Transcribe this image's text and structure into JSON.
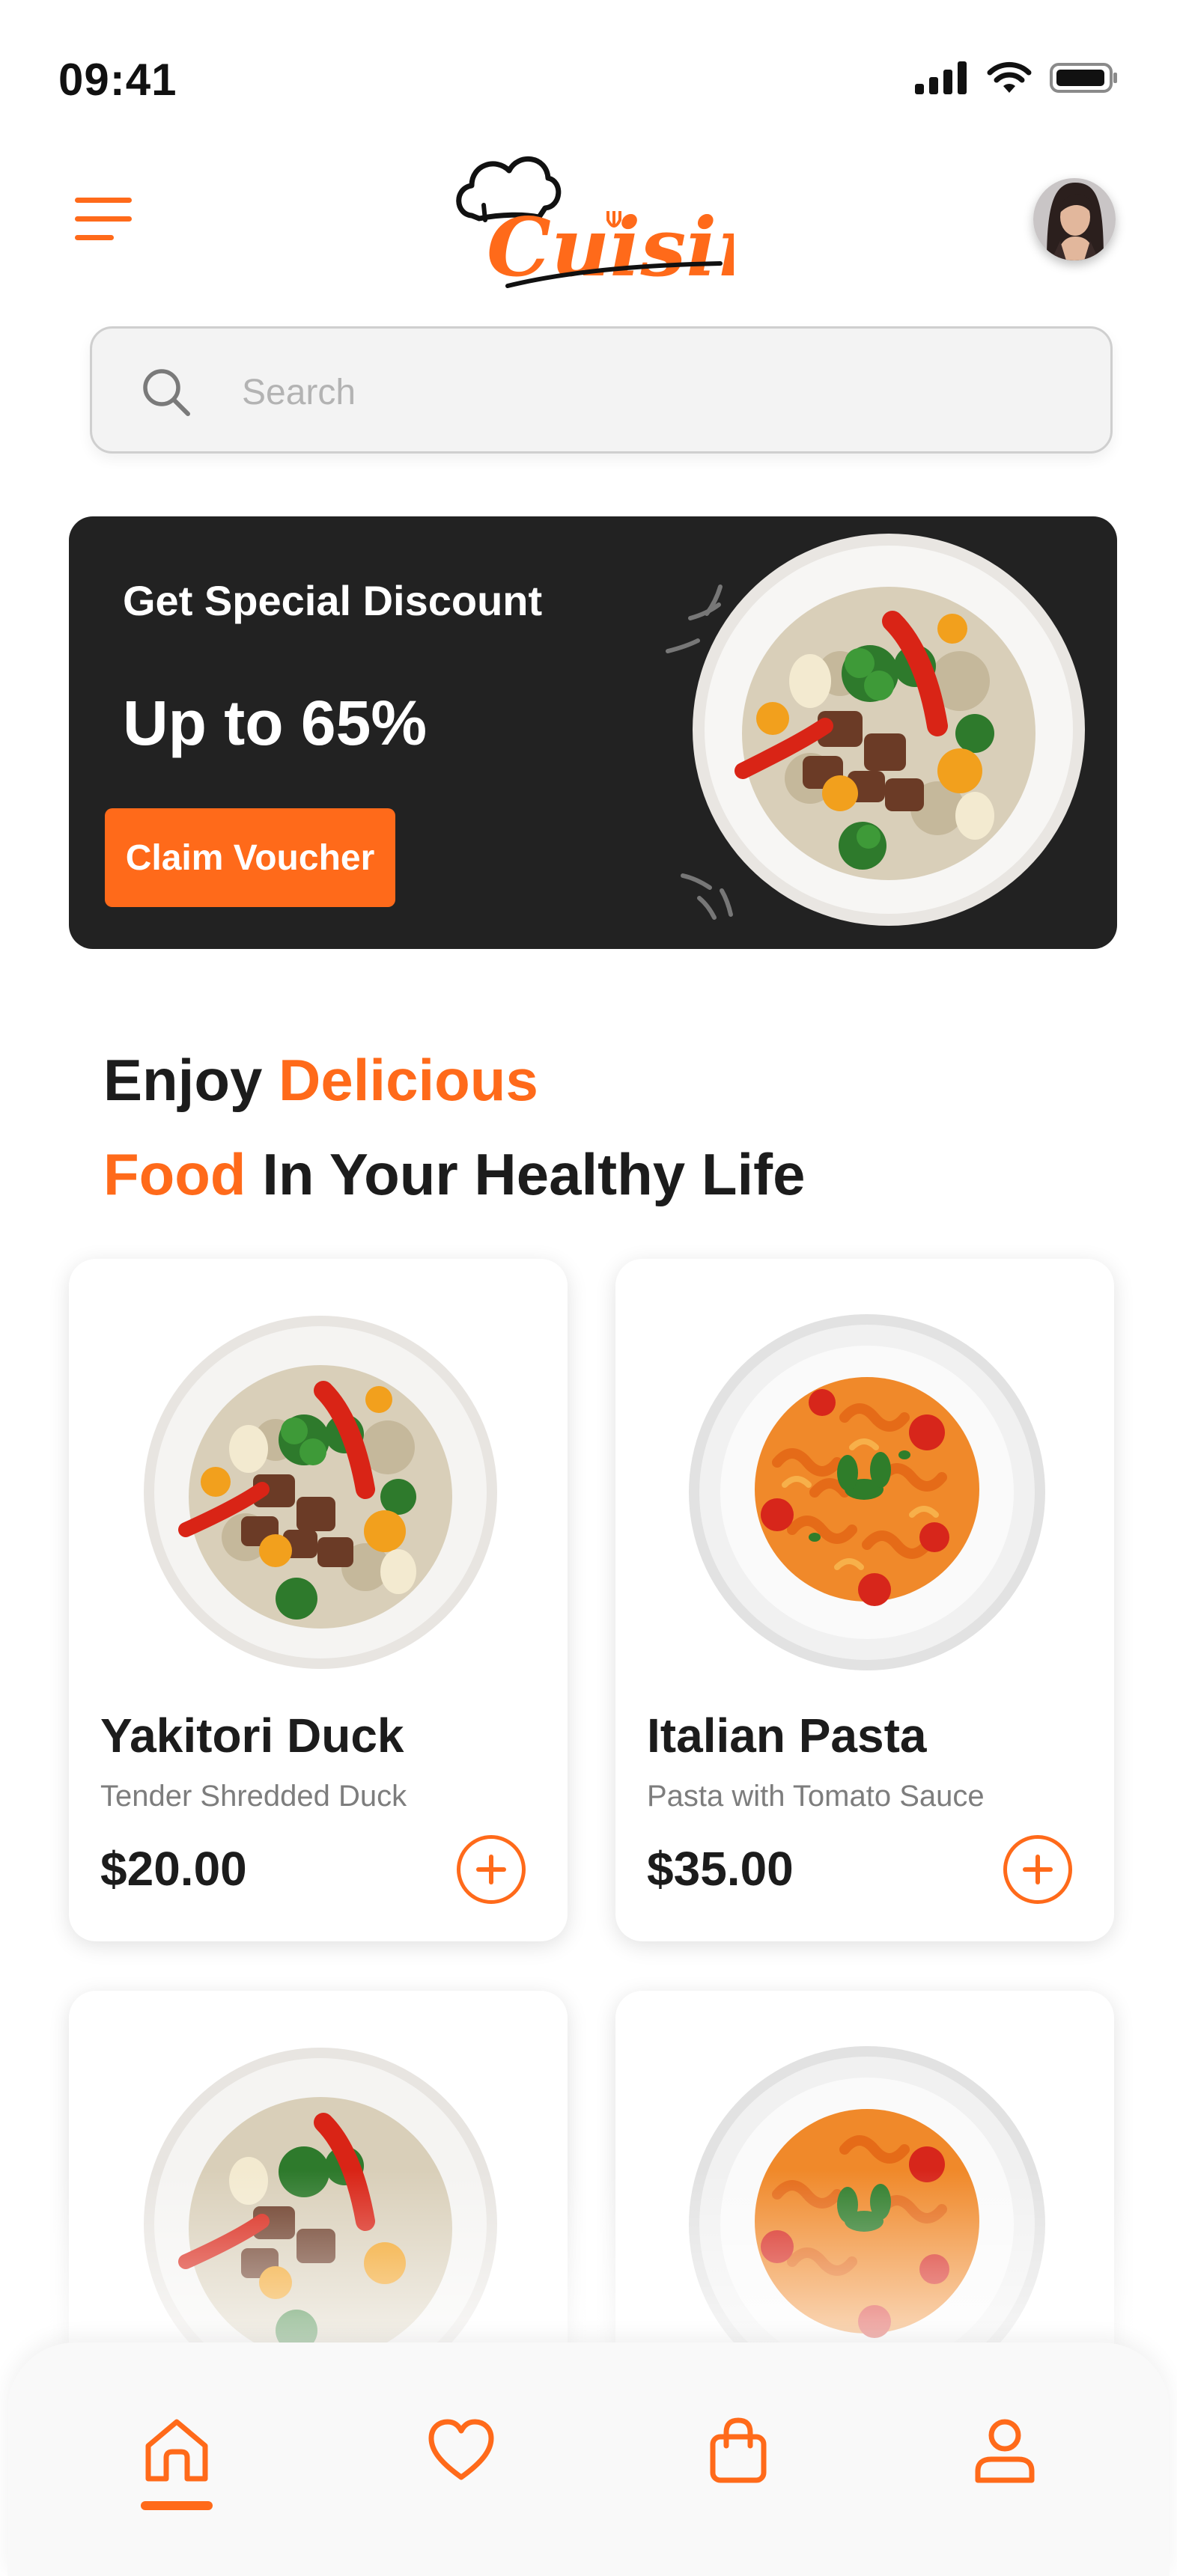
{
  "status_bar": {
    "time": "09:41"
  },
  "header": {
    "logo_text": "Cuisine"
  },
  "search": {
    "placeholder": "Search"
  },
  "promo": {
    "subtitle": "Get Special Discount",
    "title": "Up to 65%",
    "button_label": "Claim Voucher"
  },
  "headline": {
    "part1": "Enjoy ",
    "part2": "Delicious",
    "part3": "Food",
    "part4": " In Your Healthy Life"
  },
  "products": [
    {
      "name": "Yakitori Duck",
      "description": "Tender Shredded Duck",
      "price": "$20.00",
      "image": "duck-plate"
    },
    {
      "name": "Italian Pasta",
      "description": "Pasta with Tomato Sauce",
      "price": "$35.00",
      "image": "pasta-plate"
    },
    {
      "name": "",
      "description": "",
      "price": "",
      "image": "duck-plate"
    },
    {
      "name": "",
      "description": "",
      "price": "",
      "image": "pasta-plate"
    }
  ],
  "bottom_nav": {
    "items": [
      "home-icon",
      "heart-icon",
      "bag-icon",
      "profile-icon"
    ],
    "active": "home-icon"
  },
  "colors": {
    "accent": "#ff6a1a",
    "banner_bg": "#222222",
    "text": "#1c1c1c"
  }
}
